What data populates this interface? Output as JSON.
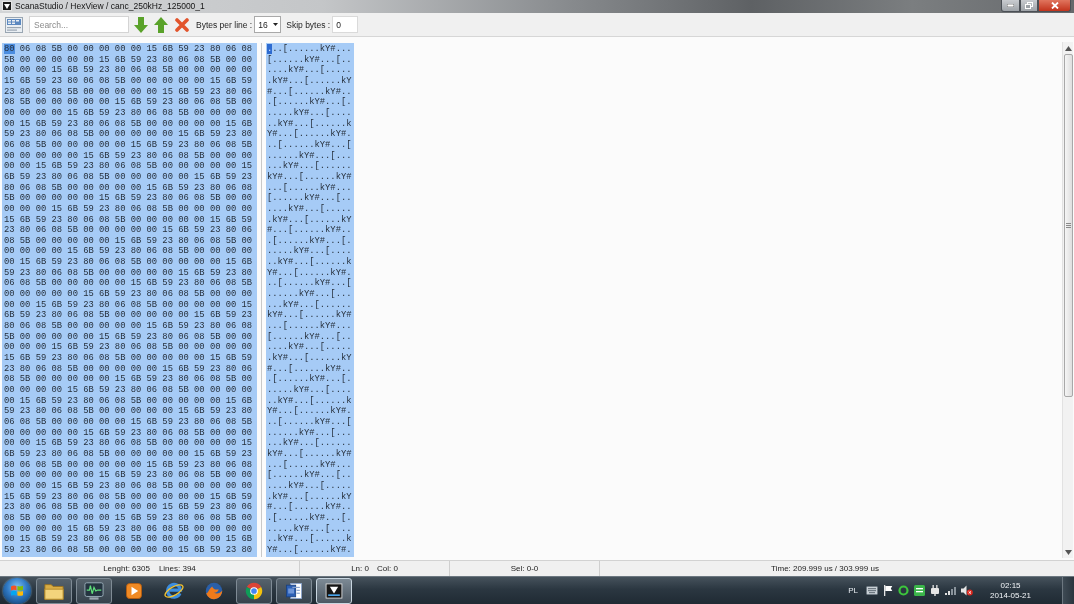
{
  "window": {
    "title": "ScanaStudio / HexView / canc_250kHz_125000_1"
  },
  "toolbar": {
    "search": {
      "placeholder": "Search..."
    },
    "bytes_per_line": {
      "label": "Bytes per line :",
      "value": "16"
    },
    "skip_bytes": {
      "label": "Skip bytes :",
      "value": "0"
    }
  },
  "hex_view": {
    "rows": [
      {
        "hex": "80 06 08 5B 00 00 00 00 00 15 6B 59 23 80 06 08",
        "ascii": "...[......kY#...",
        "cursor": true
      },
      {
        "hex": "5B 00 00 00 00 00 15 6B 59 23 80 06 08 5B 00 00",
        "ascii": "[......kY#...[..",
        "cursor": false
      },
      {
        "hex": "00 00 00 15 6B 59 23 80 06 08 5B 00 00 00 00 00",
        "ascii": "....kY#...[.....",
        "cursor": false
      },
      {
        "hex": "15 6B 59 23 80 06 08 5B 00 00 00 00 00 15 6B 59",
        "ascii": ".kY#...[......kY",
        "cursor": false
      },
      {
        "hex": "23 80 06 08 5B 00 00 00 00 00 15 6B 59 23 80 06",
        "ascii": "#...[......kY#..",
        "cursor": false
      },
      {
        "hex": "08 5B 00 00 00 00 00 15 6B 59 23 80 06 08 5B 00",
        "ascii": ".[......kY#...[.",
        "cursor": false
      },
      {
        "hex": "00 00 00 00 15 6B 59 23 80 06 08 5B 00 00 00 00",
        "ascii": ".....kY#...[....",
        "cursor": false
      },
      {
        "hex": "00 15 6B 59 23 80 06 08 5B 00 00 00 00 00 15 6B",
        "ascii": "..kY#...[......k",
        "cursor": false
      },
      {
        "hex": "59 23 80 06 08 5B 00 00 00 00 00 15 6B 59 23 80",
        "ascii": "Y#...[......kY#.",
        "cursor": false
      },
      {
        "hex": "06 08 5B 00 00 00 00 00 15 6B 59 23 80 06 08 5B",
        "ascii": "..[......kY#...[",
        "cursor": false
      },
      {
        "hex": "00 00 00 00 00 15 6B 59 23 80 06 08 5B 00 00 00",
        "ascii": "......kY#...[...",
        "cursor": false
      },
      {
        "hex": "00 00 15 6B 59 23 80 06 08 5B 00 00 00 00 00 15",
        "ascii": "...kY#...[......",
        "cursor": false
      },
      {
        "hex": "6B 59 23 80 06 08 5B 00 00 00 00 00 15 6B 59 23",
        "ascii": "kY#...[......kY#",
        "cursor": false
      },
      {
        "hex": "80 06 08 5B 00 00 00 00 00 15 6B 59 23 80 06 08",
        "ascii": "...[......kY#...",
        "cursor": false
      },
      {
        "hex": "5B 00 00 00 00 00 15 6B 59 23 80 06 08 5B 00 00",
        "ascii": "[......kY#...[..",
        "cursor": false
      },
      {
        "hex": "00 00 00 15 6B 59 23 80 06 08 5B 00 00 00 00 00",
        "ascii": "....kY#...[.....",
        "cursor": false
      },
      {
        "hex": "15 6B 59 23 80 06 08 5B 00 00 00 00 00 15 6B 59",
        "ascii": ".kY#...[......kY",
        "cursor": false
      },
      {
        "hex": "23 80 06 08 5B 00 00 00 00 00 15 6B 59 23 80 06",
        "ascii": "#...[......kY#..",
        "cursor": false
      },
      {
        "hex": "08 5B 00 00 00 00 00 15 6B 59 23 80 06 08 5B 00",
        "ascii": ".[......kY#...[.",
        "cursor": false
      },
      {
        "hex": "00 00 00 00 15 6B 59 23 80 06 08 5B 00 00 00 00",
        "ascii": ".....kY#...[....",
        "cursor": false
      },
      {
        "hex": "00 15 6B 59 23 80 06 08 5B 00 00 00 00 00 15 6B",
        "ascii": "..kY#...[......k",
        "cursor": false
      },
      {
        "hex": "59 23 80 06 08 5B 00 00 00 00 00 15 6B 59 23 80",
        "ascii": "Y#...[......kY#.",
        "cursor": false
      },
      {
        "hex": "06 08 5B 00 00 00 00 00 15 6B 59 23 80 06 08 5B",
        "ascii": "..[......kY#...[",
        "cursor": false
      },
      {
        "hex": "00 00 00 00 00 15 6B 59 23 80 06 08 5B 00 00 00",
        "ascii": "......kY#...[...",
        "cursor": false
      },
      {
        "hex": "00 00 15 6B 59 23 80 06 08 5B 00 00 00 00 00 15",
        "ascii": "...kY#...[......",
        "cursor": false
      },
      {
        "hex": "6B 59 23 80 06 08 5B 00 00 00 00 00 15 6B 59 23",
        "ascii": "kY#...[......kY#",
        "cursor": false
      },
      {
        "hex": "80 06 08 5B 00 00 00 00 00 15 6B 59 23 80 06 08",
        "ascii": "...[......kY#...",
        "cursor": false
      },
      {
        "hex": "5B 00 00 00 00 00 15 6B 59 23 80 06 08 5B 00 00",
        "ascii": "[......kY#...[..",
        "cursor": false
      },
      {
        "hex": "00 00 00 15 6B 59 23 80 06 08 5B 00 00 00 00 00",
        "ascii": "....kY#...[.....",
        "cursor": false
      },
      {
        "hex": "15 6B 59 23 80 06 08 5B 00 00 00 00 00 15 6B 59",
        "ascii": ".kY#...[......kY",
        "cursor": false
      },
      {
        "hex": "23 80 06 08 5B 00 00 00 00 00 15 6B 59 23 80 06",
        "ascii": "#...[......kY#..",
        "cursor": false
      },
      {
        "hex": "08 5B 00 00 00 00 00 15 6B 59 23 80 06 08 5B 00",
        "ascii": ".[......kY#...[.",
        "cursor": false
      },
      {
        "hex": "00 00 00 00 15 6B 59 23 80 06 08 5B 00 00 00 00",
        "ascii": ".....kY#...[....",
        "cursor": false
      },
      {
        "hex": "00 15 6B 59 23 80 06 08 5B 00 00 00 00 00 15 6B",
        "ascii": "..kY#...[......k",
        "cursor": false
      },
      {
        "hex": "59 23 80 06 08 5B 00 00 00 00 00 15 6B 59 23 80",
        "ascii": "Y#...[......kY#.",
        "cursor": false
      },
      {
        "hex": "06 08 5B 00 00 00 00 00 15 6B 59 23 80 06 08 5B",
        "ascii": "..[......kY#...[",
        "cursor": false
      },
      {
        "hex": "00 00 00 00 00 15 6B 59 23 80 06 08 5B 00 00 00",
        "ascii": "......kY#...[...",
        "cursor": false
      },
      {
        "hex": "00 00 15 6B 59 23 80 06 08 5B 00 00 00 00 00 15",
        "ascii": "...kY#...[......",
        "cursor": false
      },
      {
        "hex": "6B 59 23 80 06 08 5B 00 00 00 00 00 15 6B 59 23",
        "ascii": "kY#...[......kY#",
        "cursor": false
      },
      {
        "hex": "80 06 08 5B 00 00 00 00 00 15 6B 59 23 80 06 08",
        "ascii": "...[......kY#...",
        "cursor": false
      },
      {
        "hex": "5B 00 00 00 00 00 15 6B 59 23 80 06 08 5B 00 00",
        "ascii": "[......kY#...[..",
        "cursor": false
      },
      {
        "hex": "00 00 00 15 6B 59 23 80 06 08 5B 00 00 00 00 00",
        "ascii": "....kY#...[.....",
        "cursor": false
      },
      {
        "hex": "15 6B 59 23 80 06 08 5B 00 00 00 00 00 15 6B 59",
        "ascii": ".kY#...[......kY",
        "cursor": false
      },
      {
        "hex": "23 80 06 08 5B 00 00 00 00 00 15 6B 59 23 80 06",
        "ascii": "#...[......kY#..",
        "cursor": false
      },
      {
        "hex": "08 5B 00 00 00 00 00 15 6B 59 23 80 06 08 5B 00",
        "ascii": ".[......kY#...[.",
        "cursor": false
      },
      {
        "hex": "00 00 00 00 15 6B 59 23 80 06 08 5B 00 00 00 00",
        "ascii": ".....kY#...[....",
        "cursor": false
      },
      {
        "hex": "00 15 6B 59 23 80 06 08 5B 00 00 00 00 00 15 6B",
        "ascii": "..kY#...[......k",
        "cursor": false
      },
      {
        "hex": "59 23 80 06 08 5B 00 00 00 00 00 15 6B 59 23 80",
        "ascii": "Y#...[......kY#.",
        "cursor": false
      }
    ]
  },
  "status_bar": {
    "length": "Lenght: 6305",
    "lines": "Lines: 394",
    "line": "Ln: 0",
    "column": "Col: 0",
    "selection": "Sel: 0-0",
    "time": "Time: 209.999 us / 303.999 us"
  },
  "taskbar": {
    "apps": [
      {
        "kind": "folder",
        "running": true,
        "selected": false
      },
      {
        "kind": "scope",
        "running": true,
        "selected": false
      },
      {
        "kind": "player",
        "running": false,
        "selected": false
      },
      {
        "kind": "ringed",
        "running": false,
        "selected": false
      },
      {
        "kind": "foxglobe",
        "running": false,
        "selected": false
      },
      {
        "kind": "segmented",
        "running": true,
        "selected": false
      },
      {
        "kind": "document",
        "running": true,
        "selected": false
      },
      {
        "kind": "apptile",
        "running": true,
        "selected": true
      }
    ],
    "tray": {
      "language": "PL",
      "time": "02:15",
      "date": "2014-05-21"
    }
  }
}
